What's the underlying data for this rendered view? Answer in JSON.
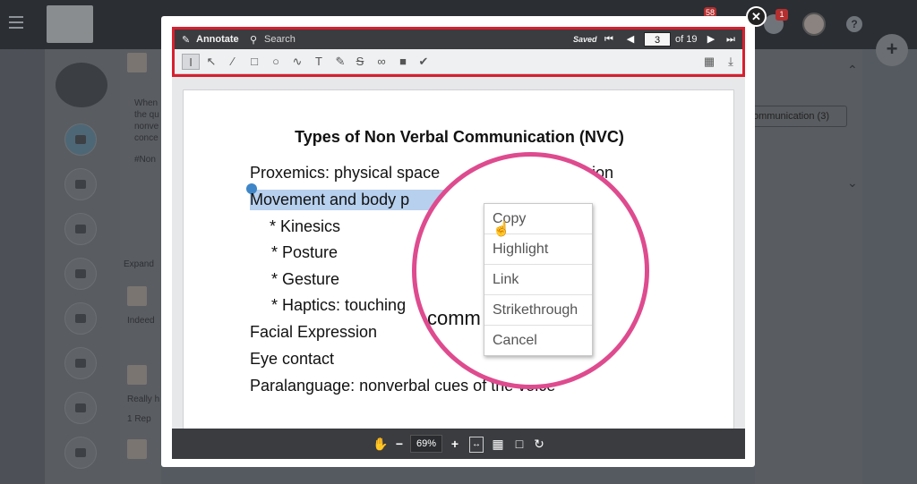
{
  "app": {
    "notification_badge": "58",
    "alert_badge": "1",
    "feed_snippets": [
      "When",
      "the qu",
      "nonve",
      "conce",
      "#Non",
      "Expand",
      "Indeed",
      "Really h",
      "1 Rep"
    ],
    "tag_chip": "ommunication (3)"
  },
  "viewer": {
    "toolbar": {
      "annotate_label": "Annotate",
      "search_label": "Search",
      "saved_status": "Saved",
      "current_page": "3",
      "page_total": "of 19"
    },
    "tools": [
      "text-select",
      "arrow",
      "line",
      "rectangle",
      "ellipse",
      "freehand",
      "text",
      "highlighter",
      "strikethrough",
      "link",
      "stamp",
      "check"
    ],
    "document": {
      "title": "Types of Non Verbal Communication (NVC)",
      "lines": [
        "Proxemics: physical space",
        "Movement and body p",
        "* Kinesics",
        "* Posture",
        "* Gesture",
        "* Haptics: touching",
        "Facial Expression",
        "Eye contact",
        "Paralanguage: nonverbal cues of the voice"
      ],
      "line1_tail": "ion",
      "magnified_text": "comm"
    },
    "context_menu": {
      "items": [
        "Copy",
        "Highlight",
        "Link",
        "Strikethrough",
        "Cancel"
      ]
    },
    "bottom_toolbar": {
      "zoom_level": "69%"
    }
  }
}
